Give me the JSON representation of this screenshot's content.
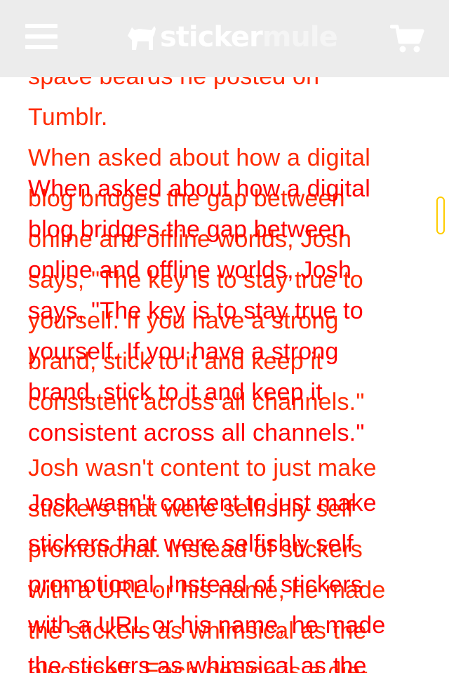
{
  "header": {
    "brand_a": "sticker",
    "brand_b": "mule"
  },
  "article": {
    "lead_fragment": "space beards he posted on\nTumblr.",
    "para_1": "When asked about how a digital\nblog bridges the gap between\nonline and offline worlds, Josh\nsays, \"The key is to stay true to\nyourself. If you have a strong\nbrand, stick to it and keep it\nconsistent across all channels.\"",
    "para_2": "Josh wasn't content to just make\nstickers that were selfishly self\npromotional. Instead of stickers\nwith a URL or his name, he made\nthe stickers as whimsical as the\nblog itself. Each design is a die-"
  },
  "overlay": {
    "para_1": "When asked about how a digital\nblog bridges the gap between\nonline and offline worlds, Josh\nsays, \"The key is to stay true to\nyourself. If you have a strong\nbrand, stick to it and keep it\nconsistent across all channels.\"",
    "para_2": "Josh wasn't content to just make\nstickers that were selfishly self\npromotional. Instead of stickers\nwith a URL or his name, he made\nthe stickers as whimsical as the"
  },
  "colors": {
    "header_bg": "#ececec",
    "text_red": "#ff0000",
    "text_yellow": "#e8e000",
    "scroll_accent": "#ffcc00"
  },
  "icons": {
    "menu": "hamburger-menu-icon",
    "logo": "mule-logo-icon",
    "cart": "shopping-cart-icon"
  }
}
